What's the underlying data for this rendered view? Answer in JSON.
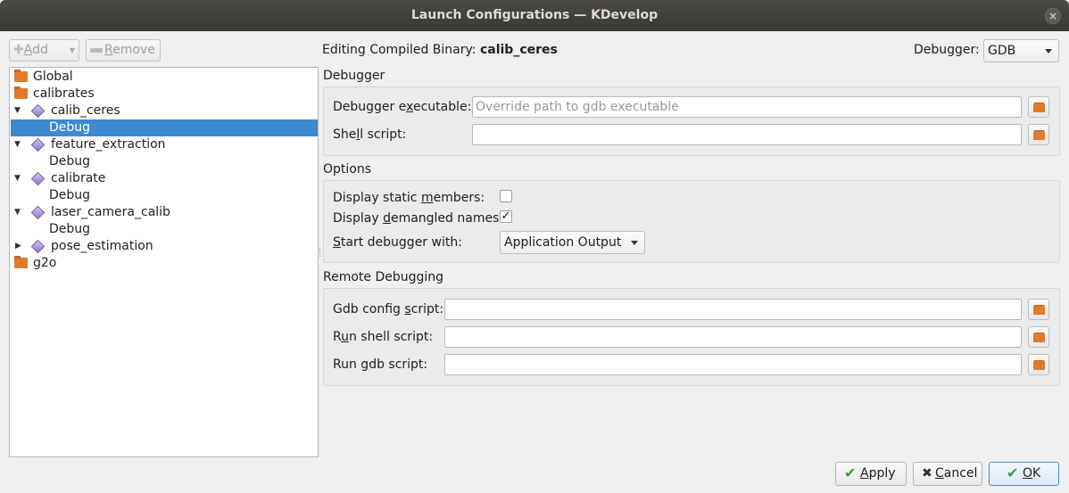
{
  "window": {
    "title": "Launch Configurations — KDevelop",
    "close_glyph": "×"
  },
  "toolbar": {
    "add_label_underlined": "A",
    "add_label_rest": "dd",
    "add_icon": "plus-icon",
    "remove_label_underlined": "R",
    "remove_label_rest": "emove",
    "remove_icon": "minus-icon"
  },
  "tree": {
    "items": [
      {
        "label": "Global",
        "type": "folder"
      },
      {
        "label": "calibrates",
        "type": "folder"
      },
      {
        "label": "calib_ceres",
        "type": "target",
        "expanded": true
      },
      {
        "label": "Debug",
        "type": "mode",
        "selected": true
      },
      {
        "label": "feature_extraction",
        "type": "target",
        "expanded": true
      },
      {
        "label": "Debug",
        "type": "mode"
      },
      {
        "label": "calibrate",
        "type": "target",
        "expanded": true
      },
      {
        "label": "Debug",
        "type": "mode"
      },
      {
        "label": "laser_camera_calib",
        "type": "target",
        "expanded": true
      },
      {
        "label": "Debug",
        "type": "mode"
      },
      {
        "label": "pose_estimation",
        "type": "target",
        "expanded": false
      },
      {
        "label": "g2o",
        "type": "folder"
      }
    ],
    "expanded_glyph": "▼",
    "collapsed_glyph": "▶"
  },
  "editing": {
    "prefix": "Editing Compiled Binary:",
    "name": "calib_ceres",
    "debugger_label": "Debugger:",
    "debugger_value": "GDB"
  },
  "debugger_section": {
    "title": "Debugger",
    "executable_label_pre": "Debugger e",
    "executable_label_u": "x",
    "executable_label_post": "ecutable:",
    "executable_placeholder": "Override path to gdb executable",
    "shell_label_pre": "She",
    "shell_label_u": "l",
    "shell_label_post": "l script:",
    "shell_value": ""
  },
  "options_section": {
    "title": "Options",
    "static_label_pre": "Display static ",
    "static_label_u": "m",
    "static_label_post": "embers:",
    "static_checked": false,
    "demangled_label_pre": "Display ",
    "demangled_label_u": "d",
    "demangled_label_post": "emangled names:",
    "demangled_checked": true,
    "check_glyph": "✓",
    "start_label_pre": "",
    "start_label_u": "S",
    "start_label_post": "tart debugger with:",
    "start_value": "Application Output"
  },
  "remote_section": {
    "title": "Remote Debugging",
    "gdb_config_pre": "Gdb config ",
    "gdb_config_u": "s",
    "gdb_config_post": "cript:",
    "gdb_config_value": "",
    "run_shell_pre": "R",
    "run_shell_u": "u",
    "run_shell_post": "n shell script:",
    "run_shell_value": "",
    "run_gdb_pre": "Run ",
    "run_gdb_u": "g",
    "run_gdb_post": "db script:",
    "run_gdb_value": ""
  },
  "buttons": {
    "apply_u": "A",
    "apply_rest": "pply",
    "apply_icon": "check-icon",
    "apply_glyph": "✔",
    "cancel_u": "C",
    "cancel_rest": "ancel",
    "cancel_icon": "x-icon",
    "cancel_glyph": "✖",
    "ok_pre": "",
    "ok_u": "O",
    "ok_rest": "K",
    "ok_icon": "check-icon",
    "ok_glyph": "✔"
  },
  "colors": {
    "selection": "#3d8ad1",
    "folder": "#e07a2c",
    "target": "#8c78c4"
  }
}
